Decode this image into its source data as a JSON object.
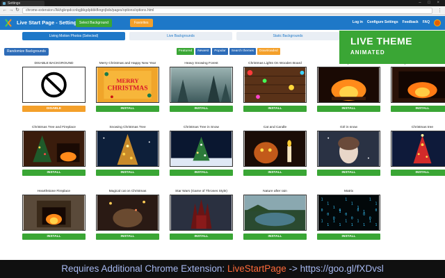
{
  "browser": {
    "tab_title": "Settings",
    "url": "chrome-extension://kkhgknpdccnbgjbbgdpbbkfkngnjbdo/pages/options/options.html",
    "window_controls": "– □ ×",
    "back_icon": "arrow-left",
    "forward_icon": "arrow-right",
    "reload_icon": "reload"
  },
  "appbar": {
    "title": "Live Start Page - Settings",
    "select_background": "Select Background",
    "favorites": "Favorites",
    "links": [
      "Log in",
      "Configure Settings",
      "Feedback",
      "FAQ"
    ],
    "brand_color": "#1e78c8"
  },
  "badge": {
    "line1": "LIVE THEME",
    "line2": "ANIMATED",
    "color": "#3aa635"
  },
  "mode_tabs": [
    {
      "label": "Living Motion Photos (Selected)",
      "active": true
    },
    {
      "label": "Live Backgrounds",
      "active": false
    },
    {
      "label": "Static Backgrounds",
      "active": false
    }
  ],
  "randomize_label": "Randomize Backgrounds",
  "filters": [
    {
      "label": "Featured",
      "style": "green"
    },
    {
      "label": "Newest",
      "style": "blue"
    },
    {
      "label": "Popular",
      "style": "blue"
    },
    {
      "label": "Search themes",
      "style": "blue"
    },
    {
      "label": "Downloaded",
      "style": "orange"
    }
  ],
  "install_label": "INSTALL",
  "disable_label": "DISABLE",
  "cards": [
    {
      "caption": "DISABLE BACKGROUND",
      "art": "disable",
      "button": "disable"
    },
    {
      "caption": "Merry Christmas and Happy New Year",
      "art": "merry",
      "art_text": [
        "MERRY",
        "CHRISTMAS"
      ],
      "button": "install"
    },
    {
      "caption": "Heavy Snowing Forest",
      "art": "snowforest",
      "button": "install"
    },
    {
      "caption": "Christmas Lights On Wooden Board",
      "art": "lightsboard",
      "button": "install"
    },
    {
      "caption": "Fireplace",
      "art": "fireplace",
      "button": "install"
    },
    {
      "caption": "Fireplace - christmas decoration",
      "art": "fireplace2",
      "button": "install"
    },
    {
      "caption": "Christmas Tree and Fireplace",
      "art": "treefire",
      "button": "install"
    },
    {
      "caption": "Snowing Christmas Tree",
      "art": "snowtree",
      "button": "install"
    },
    {
      "caption": "Christmas Tree in Snow",
      "art": "treesnow",
      "button": "install"
    },
    {
      "caption": "Cat and Candle",
      "art": "catcandle",
      "button": "install"
    },
    {
      "caption": "Girl in snow",
      "art": "girlsnow",
      "button": "install"
    },
    {
      "caption": "Christmas tree",
      "art": "xtree",
      "button": "install"
    },
    {
      "caption": "Hearthstone Fireplace",
      "art": "hearth",
      "button": "install"
    },
    {
      "caption": "Magical cat on Christmas",
      "art": "magiccat",
      "button": "install"
    },
    {
      "caption": "Star Wars (Game of Thrones Style)",
      "art": "throne",
      "button": "install"
    },
    {
      "caption": "Nature after rain",
      "art": "nature",
      "button": "install"
    },
    {
      "caption": "Matrix",
      "art": "matrix",
      "button": "install"
    }
  ],
  "bottom_banner": {
    "prefix": "Requires Additional Chrome Extension: ",
    "accent": "LiveStartPage",
    "suffix": " -> https://goo.gl/fXDvsl"
  }
}
